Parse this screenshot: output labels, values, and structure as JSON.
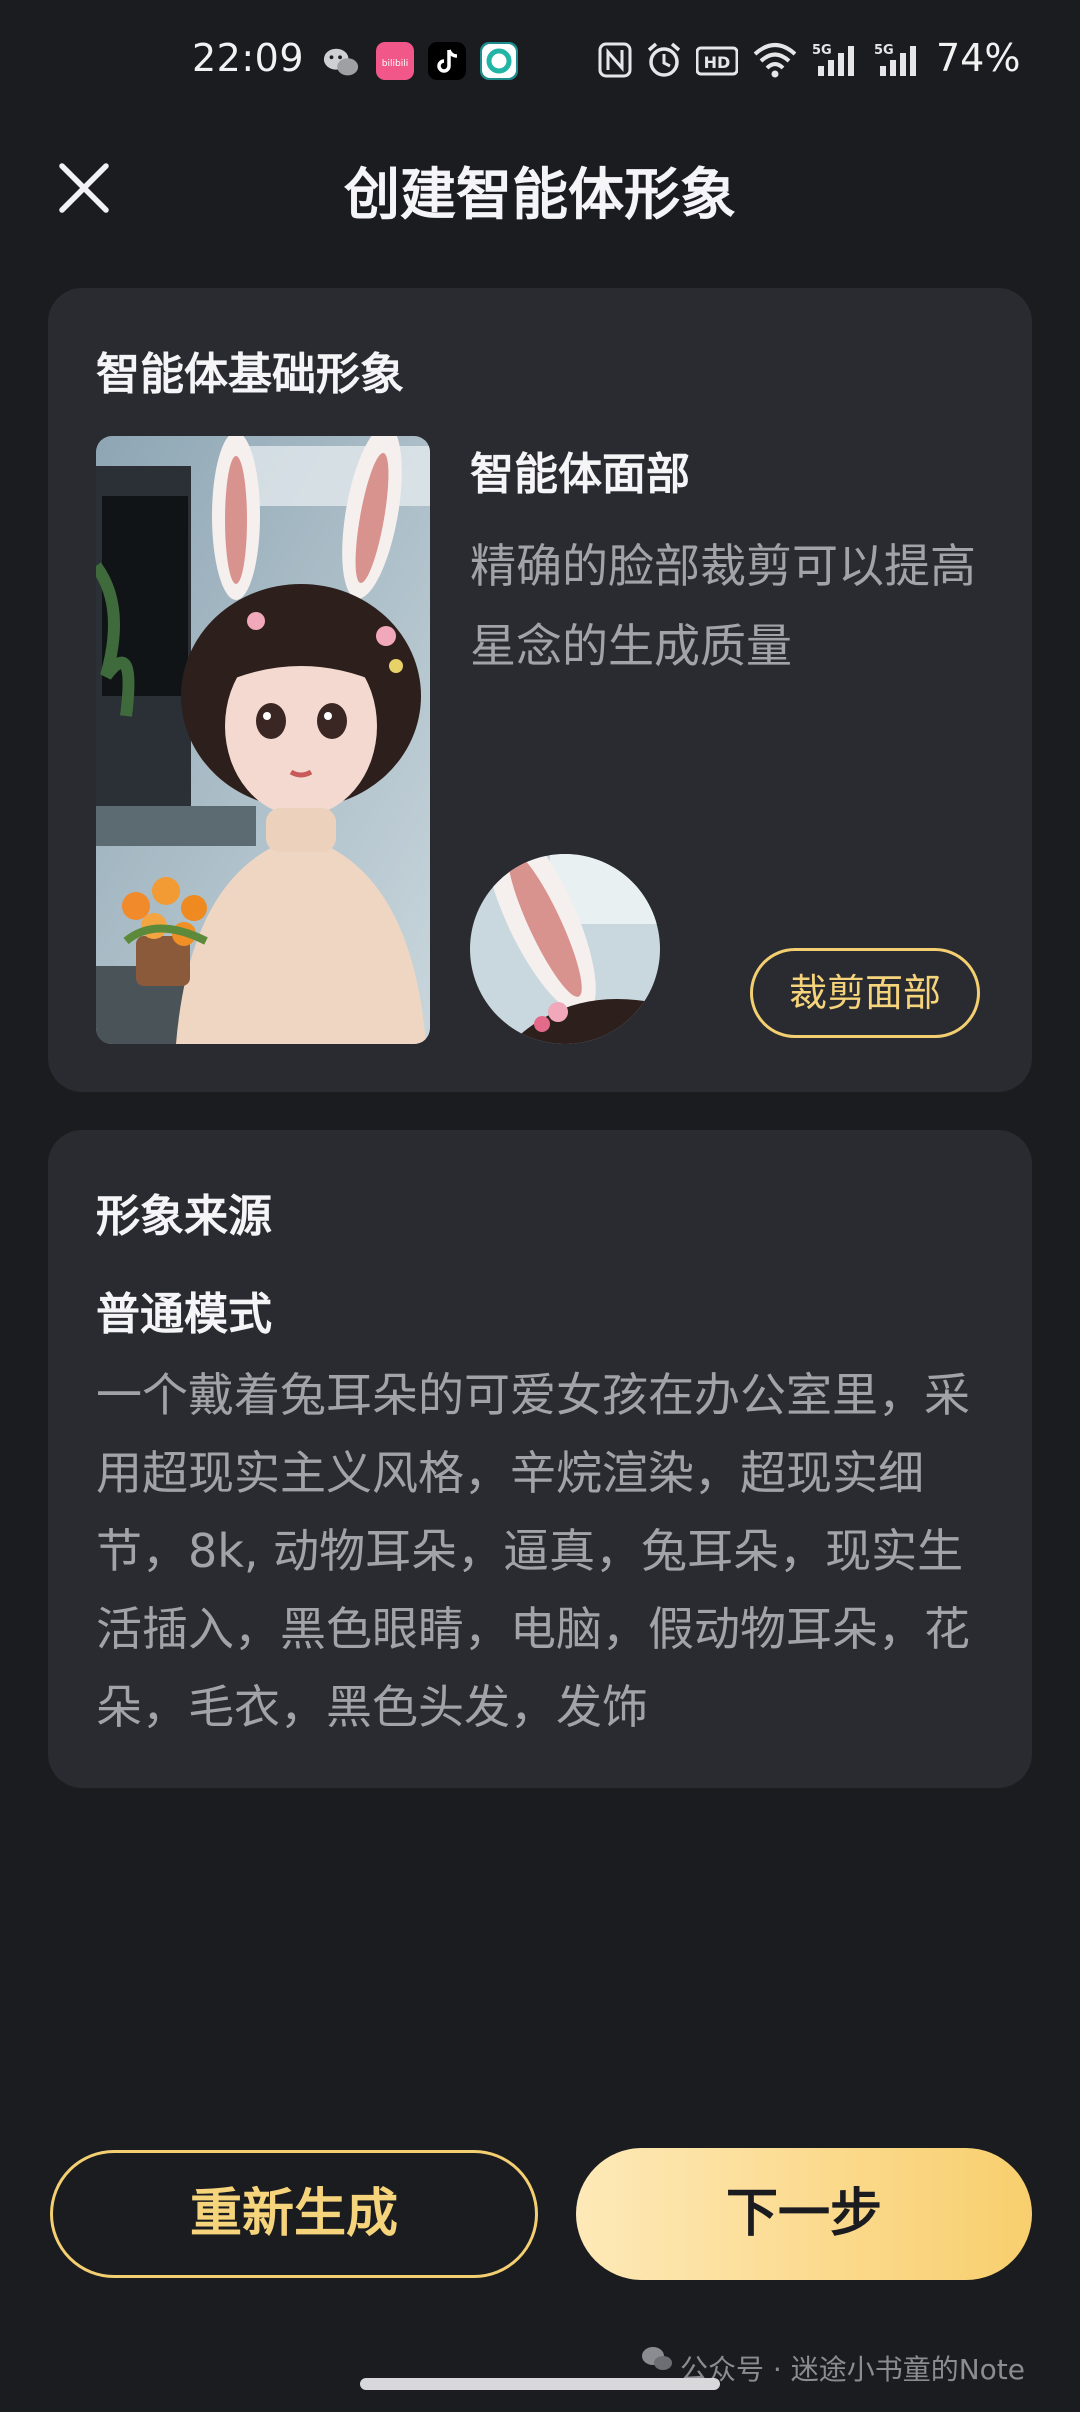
{
  "status_bar": {
    "time": "22:09",
    "battery": "74%",
    "icons": [
      "wechat-icon",
      "bilibili-icon",
      "tiktok-icon",
      "ring-app-icon",
      "nfc-icon",
      "alarm-icon",
      "hd-icon",
      "wifi-icon",
      "signal-5g-icon",
      "signal-5g-icon"
    ],
    "bili_label": "bilibili",
    "hd_label": "HD",
    "net_label": "5G"
  },
  "header": {
    "title": "创建智能体形象",
    "close_icon": "close-icon"
  },
  "base_card": {
    "title": "智能体基础形象",
    "face_title": "智能体面部",
    "face_desc": "精确的脸部裁剪可以提高星念的生成质量",
    "crop_button": "裁剪面部"
  },
  "source_card": {
    "title": "形象来源",
    "mode": "普通模式",
    "prompt": "一个戴着兔耳朵的可爱女孩在办公室里，采用超现实主义风格，辛烷渲染，超现实细节，8k, 动物耳朵，逼真，兔耳朵，现实生活插入，黑色眼睛，电脑，假动物耳朵，花朵，毛衣，黑色头发，发饰"
  },
  "actions": {
    "regenerate": "重新生成",
    "next": "下一步"
  },
  "watermark": "公众号 · 迷途小书童的Note",
  "colors": {
    "background": "#1b1c20",
    "card": "#2a2b30",
    "accent": "#f6d47b",
    "muted_text": "#a2a3a8"
  }
}
